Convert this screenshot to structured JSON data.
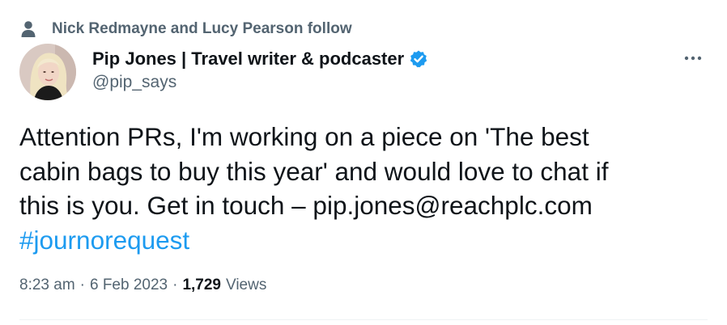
{
  "social_context": {
    "text": "Nick Redmayne and Lucy Pearson follow",
    "icon": "person-icon"
  },
  "author": {
    "display_name": "Pip Jones | Travel writer & podcaster",
    "handle": "@pip_says",
    "verified": true,
    "verified_color": "#1d9bf0",
    "avatar_icon": "avatar"
  },
  "more_button": {
    "icon": "more-horizontal-icon"
  },
  "tweet": {
    "lines": [
      "Attention PRs, I'm working on a piece on 'The best",
      "cabin bags to buy this year' and would love to chat if",
      "this is you. Get in touch – pip.jones@reachplc.com"
    ],
    "hashtag": "#journorequest",
    "hashtag_color": "#1d9bf0"
  },
  "meta": {
    "time": "8:23 am",
    "separator": "·",
    "date": "6 Feb 2023",
    "views_count": "1,729",
    "views_label": "Views"
  },
  "colors": {
    "text_primary": "#0f1419",
    "text_secondary": "#536471",
    "accent": "#1d9bf0",
    "divider": "#eff3f4"
  }
}
